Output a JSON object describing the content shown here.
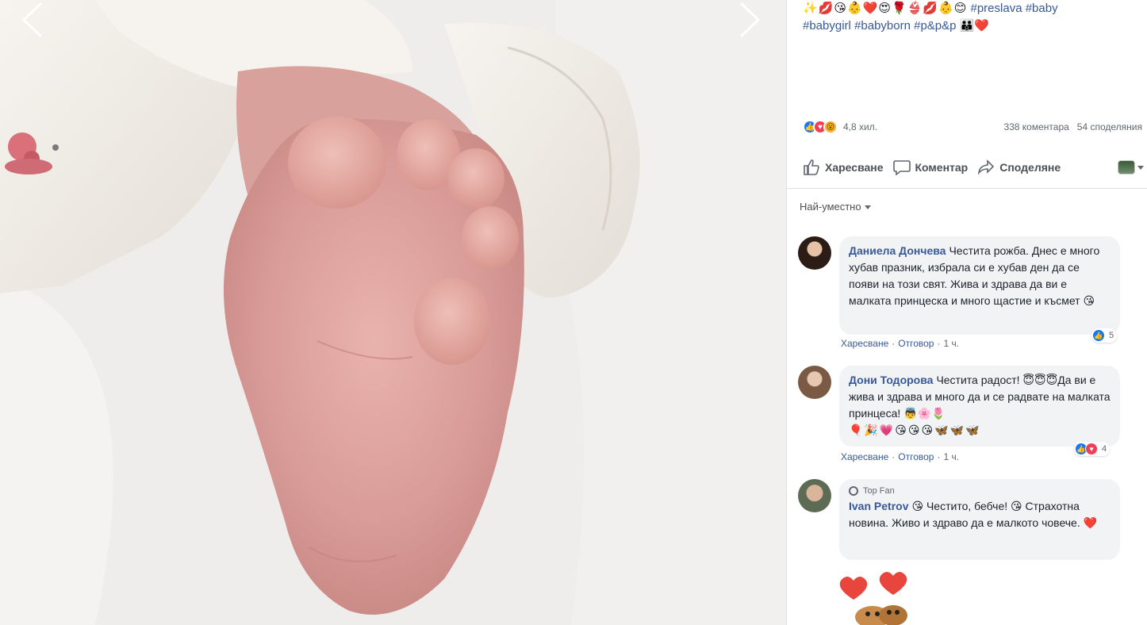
{
  "photo": {
    "prev_arrow": "chevron-left-icon",
    "next_arrow": "chevron-right-icon"
  },
  "caption": {
    "emojis": "✨💋😘👶❤️😍🌹👙💋👶😊",
    "tags_line1": "#preslava #baby",
    "tags_line2": "#babygirl #babyborn #p&p&p",
    "trailing_emojis": "👪❤️"
  },
  "stats": {
    "reactions_count": "4,8 хил.",
    "comments": "338 коментара",
    "shares": "54 споделяния"
  },
  "actions": {
    "like": "Харесване",
    "comment": "Коментар",
    "share": "Споделяне"
  },
  "sort": {
    "label": "Най-уместно"
  },
  "comments": [
    {
      "name": "Даниела Дончева",
      "text": "Честита рожба. Днес е много хубав празник, избрала си е хубав ден да се появи на този свят. Жива и здрава да ви е малката принцеска и много щастие и късмет 😘",
      "like": "Харесване",
      "reply": "Отговор",
      "time": "1 ч.",
      "reaction_count": "5"
    },
    {
      "name": "Дони Тодорова",
      "text": "Честита радост! 😇😇😇Да ви е жива и здрава и много да и се радвате на малката принцеса! 👼🌸🌷",
      "emoji_line": "🎈🎉💗😘😘😘🦋🦋🦋",
      "like": "Харесване",
      "reply": "Отговор",
      "time": "1 ч.",
      "reaction_count": "4"
    },
    {
      "badge": "Top Fan",
      "name": "Ivan Petrov",
      "text": "😘 Честито, бебче! 😘 Страхотна новина. Живо и здраво да е малкото човече. ❤️"
    }
  ],
  "colors": {
    "link": "#385898",
    "like_blue": "#1877f2",
    "love_red": "#f33e58",
    "bubble": "#f2f3f5"
  }
}
